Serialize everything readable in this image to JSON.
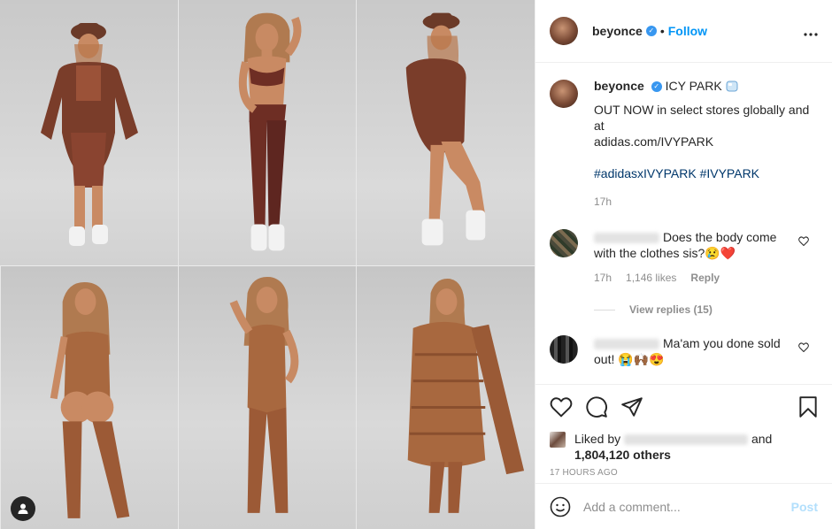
{
  "header": {
    "username": "beyonce",
    "verified_badge": "✓",
    "separator": "•",
    "follow_label": "Follow",
    "more_icon": "more-horizontal-icon"
  },
  "caption": {
    "username": "beyonce",
    "title_text": "ICY PARK",
    "title_emoji": "ice-cube-icon",
    "line1": "OUT NOW in select stores globally and at",
    "line2": "adidas.com/IVYPARK",
    "hashtags": "#adidasxIVYPARK #IVYPARK",
    "time": "17h"
  },
  "comments": [
    {
      "text": "Does the body come with the clothes sis?",
      "emoji": "😢❤️",
      "time": "17h",
      "likes": "1,146 likes",
      "reply_label": "Reply",
      "view_replies": "View replies (15)"
    },
    {
      "text": "Ma'am you done sold out!",
      "emoji": "😭🙌🏾😍"
    }
  ],
  "actions": {
    "liked_by_prefix": "Liked by",
    "liked_by_and": "and",
    "likes_count": "1,804,120 others",
    "timestamp": "17 HOURS AGO"
  },
  "add_comment": {
    "placeholder": "Add a comment...",
    "post_label": "Post"
  },
  "colors": {
    "accent": "#0095f6",
    "post_disabled": "#b2dffc",
    "muted_text": "#8e8e8e",
    "hashtag": "#00376b"
  }
}
